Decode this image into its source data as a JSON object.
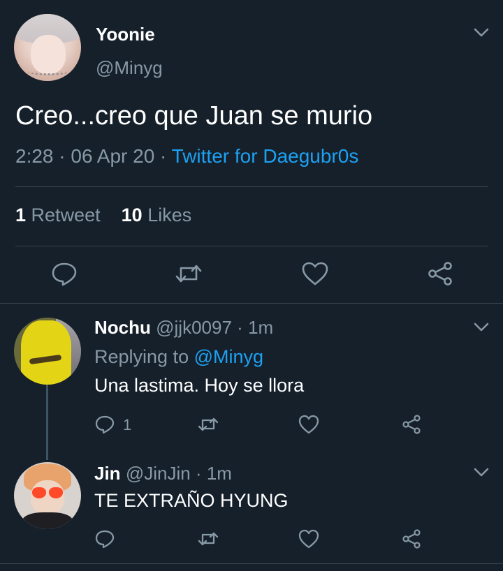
{
  "main_tweet": {
    "name": "Yoonie",
    "handle": "@Minyg",
    "text": "Creo...creo que Juan se murio",
    "time": "2:28",
    "sep1": "·",
    "date": "06 Apr 20",
    "sep2": "·",
    "source": "Twitter for Daegubr0s",
    "retweet_count": "1",
    "retweet_label": "Retweet",
    "like_count": "10",
    "like_label": "Likes"
  },
  "replies": [
    {
      "name": "Nochu",
      "handle": "@jjk0097",
      "sep": "·",
      "time": "1m",
      "replying_prefix": "Replying to",
      "replying_mention": "@Minyg",
      "text": "Una lastima. Hoy se llora",
      "reply_count": "1"
    },
    {
      "name": "Jin",
      "handle": "@JinJin",
      "sep": "·",
      "time": "1m",
      "text": "TE EXTRAÑO HYUNG"
    }
  ],
  "colors": {
    "background": "#15202b",
    "accent": "#1da1f2",
    "secondary_text": "#8899a6",
    "divider": "#38444d"
  },
  "icons": [
    "chevron-down-icon",
    "reply-icon",
    "retweet-icon",
    "like-icon",
    "share-icon"
  ]
}
